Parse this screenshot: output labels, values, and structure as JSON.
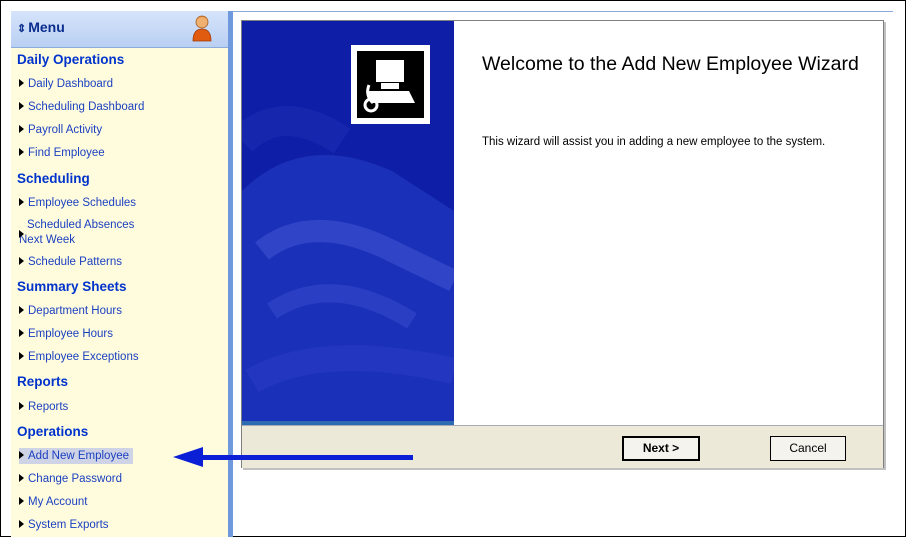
{
  "sidebar": {
    "menu_title": "Menu",
    "sections": [
      {
        "title": "Daily Operations",
        "items": [
          "Daily Dashboard",
          "Scheduling Dashboard",
          "Payroll Activity",
          "Find Employee"
        ]
      },
      {
        "title": "Scheduling",
        "items": [
          "Employee Schedules",
          "Scheduled Absences Next Week",
          "Schedule Patterns"
        ]
      },
      {
        "title": "Summary Sheets",
        "items": [
          "Department Hours",
          "Employee Hours",
          "Employee Exceptions"
        ]
      },
      {
        "title": "Reports",
        "items": [
          "Reports"
        ]
      },
      {
        "title": "Operations",
        "items": [
          "Add New Employee",
          "Change Password",
          "My Account",
          "System Exports"
        ]
      }
    ],
    "scheduled_absences_line1": "Scheduled Absences",
    "scheduled_absences_line2": "Next Week",
    "selected_item": "Add New Employee"
  },
  "wizard": {
    "title": "Welcome to the Add New Employee Wizard",
    "description": "This wizard will assist you in adding a new employee to the system.",
    "next_label": "Next >",
    "cancel_label": "Cancel"
  },
  "colors": {
    "sidebar_bg": "#fffcde",
    "link": "#1a3fc0",
    "section": "#0033cc",
    "wizard_panel": "#0e1ea6",
    "arrow": "#0a1fd6"
  },
  "icons": [
    "menu-arrows-icon",
    "user-avatar-icon",
    "wizard-computer-icon",
    "bullet-triangle-icon",
    "pointer-arrow-icon"
  ]
}
